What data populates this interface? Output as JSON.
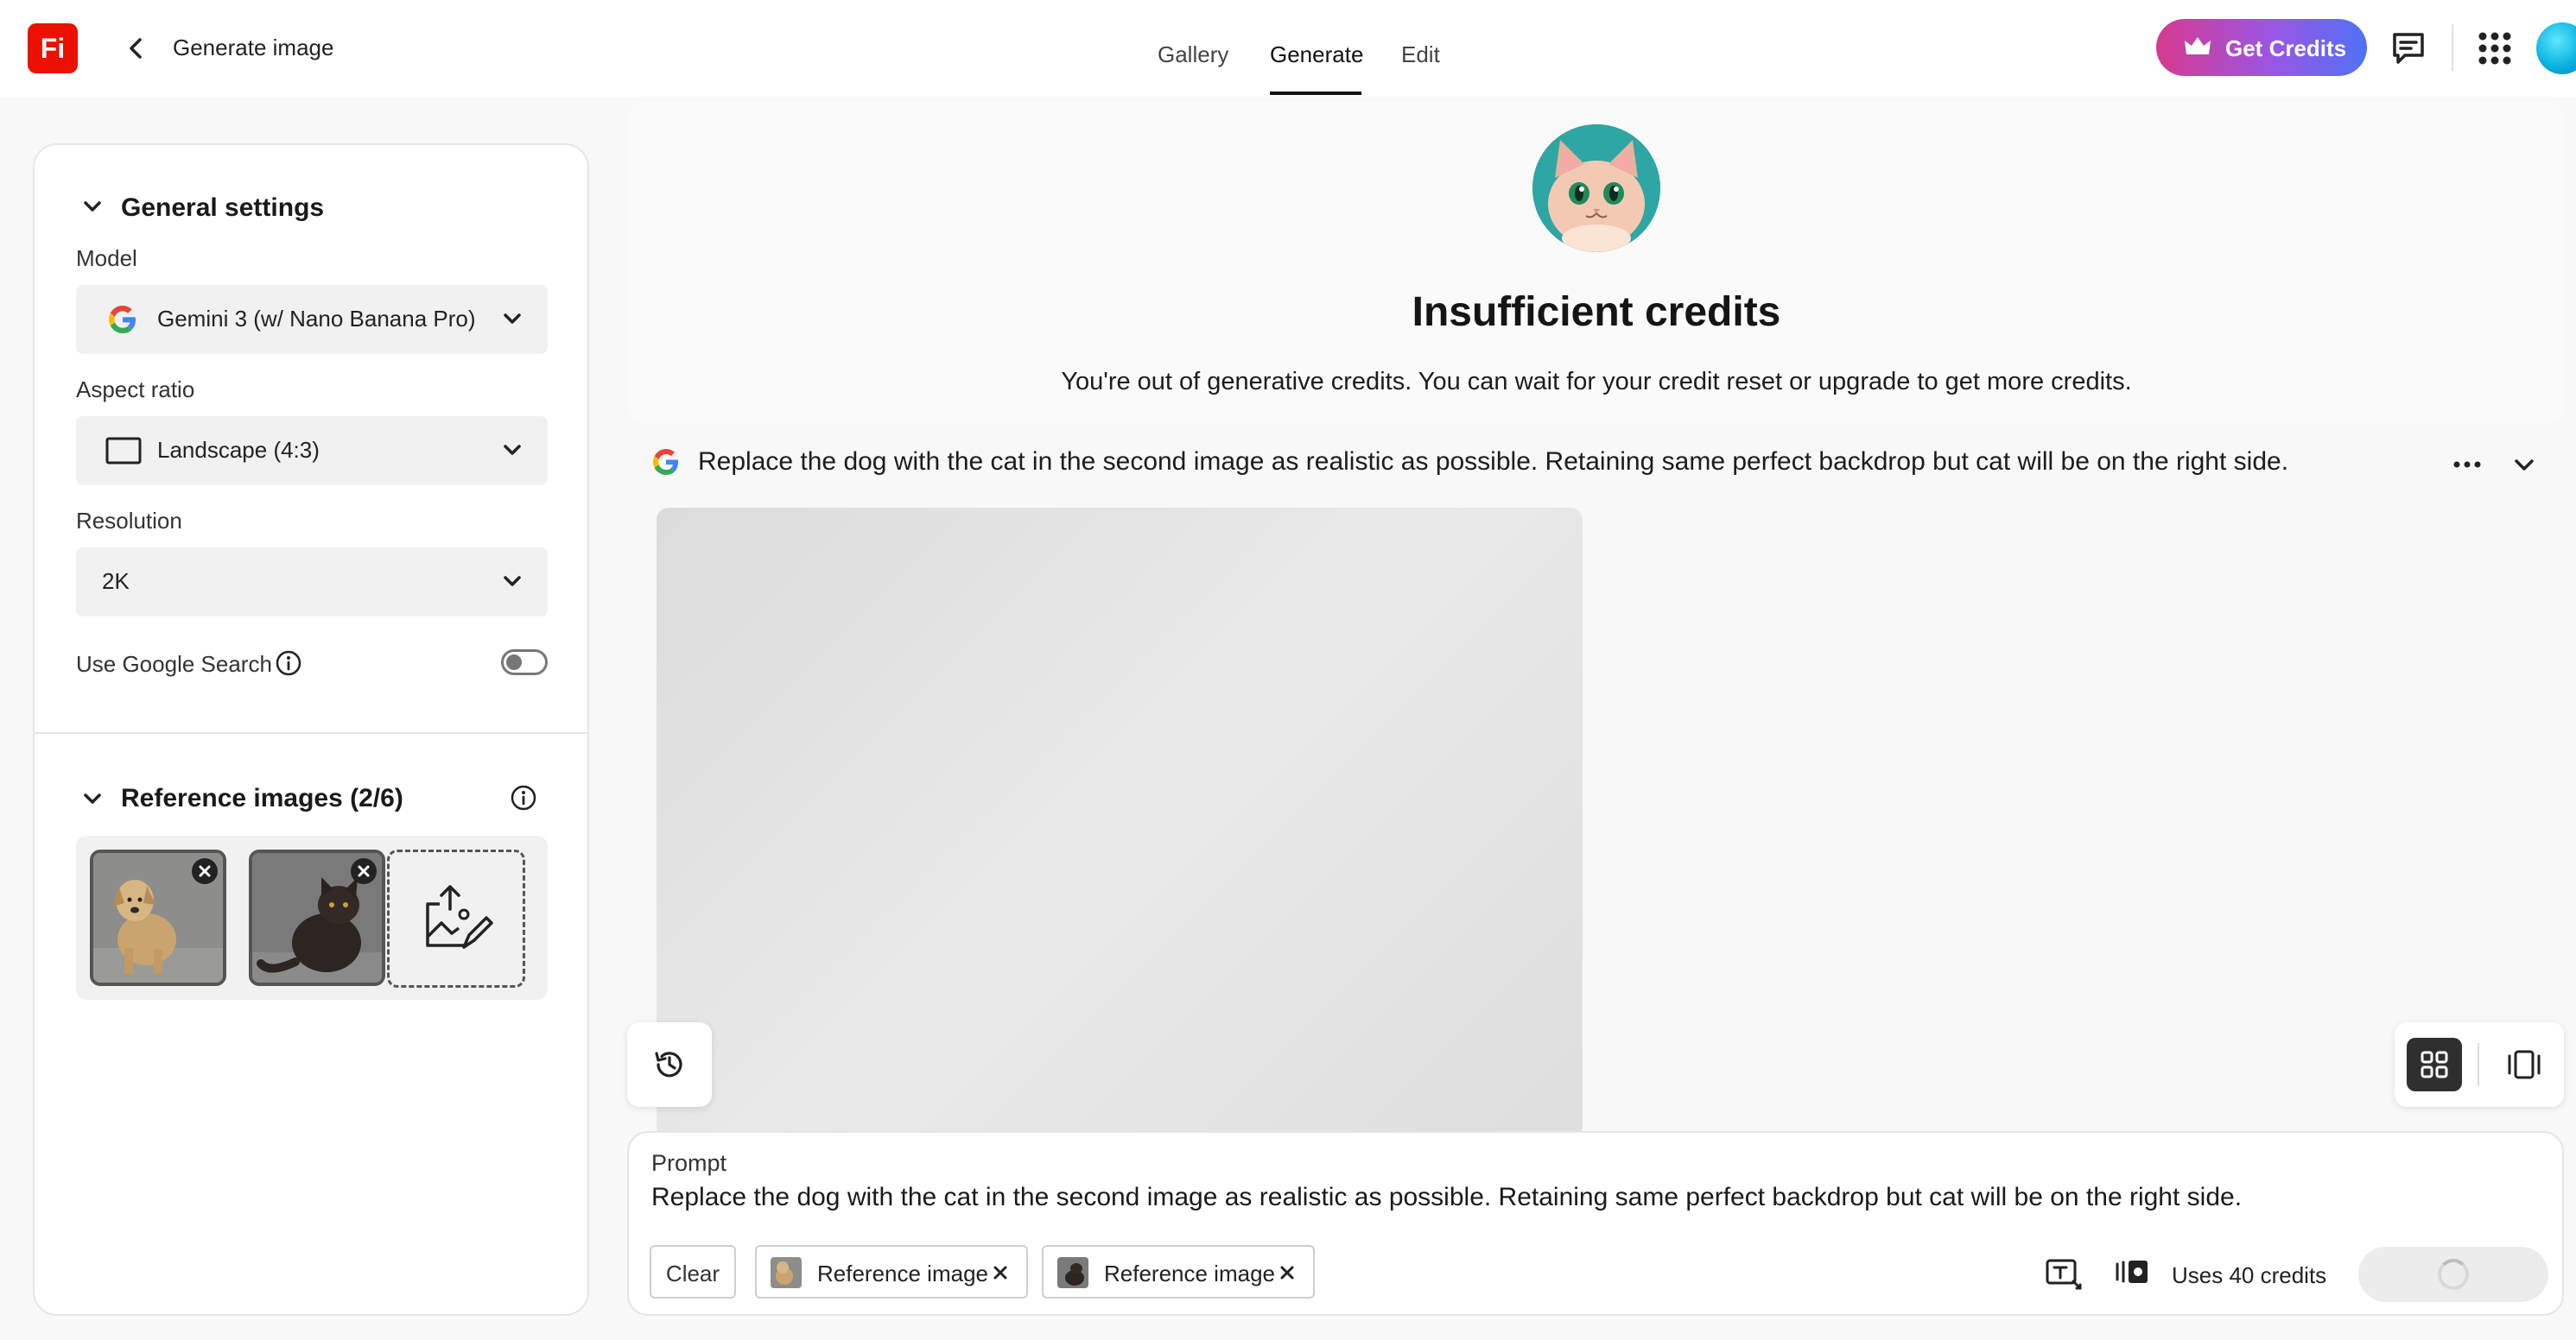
{
  "header": {
    "logo_text": "Fi",
    "title": "Generate image",
    "tabs": [
      {
        "label": "Gallery",
        "active": false
      },
      {
        "label": "Generate",
        "active": true
      },
      {
        "label": "Edit",
        "active": false
      }
    ],
    "get_credits_label": "Get Credits",
    "icons": [
      "back-arrow-icon",
      "crown-icon",
      "feedback-icon",
      "apps-grid-icon"
    ]
  },
  "settings": {
    "general_title": "General settings",
    "model_label": "Model",
    "model_value": "Gemini 3 (w/ Nano Banana Pro)",
    "aspect_label": "Aspect ratio",
    "aspect_value": "Landscape (4:3)",
    "resolution_label": "Resolution",
    "resolution_value": "2K",
    "google_search_label": "Use Google Search",
    "google_search_enabled": false,
    "reference_title": "Reference images (2/6)",
    "reference_images": [
      {
        "subject": "dog"
      },
      {
        "subject": "cat"
      }
    ]
  },
  "error": {
    "title": "Insufficient credits",
    "description": "You're out of generative credits. You can wait for your credit reset or upgrade to get more credits."
  },
  "generation": {
    "prompt_text": "Replace the dog with the cat in the second image as realistic as possible. Retaining same perfect backdrop but cat will be on the right side."
  },
  "prompt_box": {
    "label": "Prompt",
    "text": "Replace the dog with the cat in the second image as realistic as possible. Retaining same perfect backdrop but cat will be on the right side.",
    "clear_label": "Clear",
    "chips": [
      {
        "label": "Reference image"
      },
      {
        "label": "Reference image"
      }
    ],
    "uses_credits": "Uses 40 credits"
  },
  "colors": {
    "brand_red": "#eb1000",
    "credits_gradient_start": "#d73a8e",
    "credits_gradient_end": "#4f72f5",
    "google_blue": "#4285F4",
    "google_red": "#EA4335",
    "google_yellow": "#FBBC05",
    "google_green": "#34A853"
  }
}
